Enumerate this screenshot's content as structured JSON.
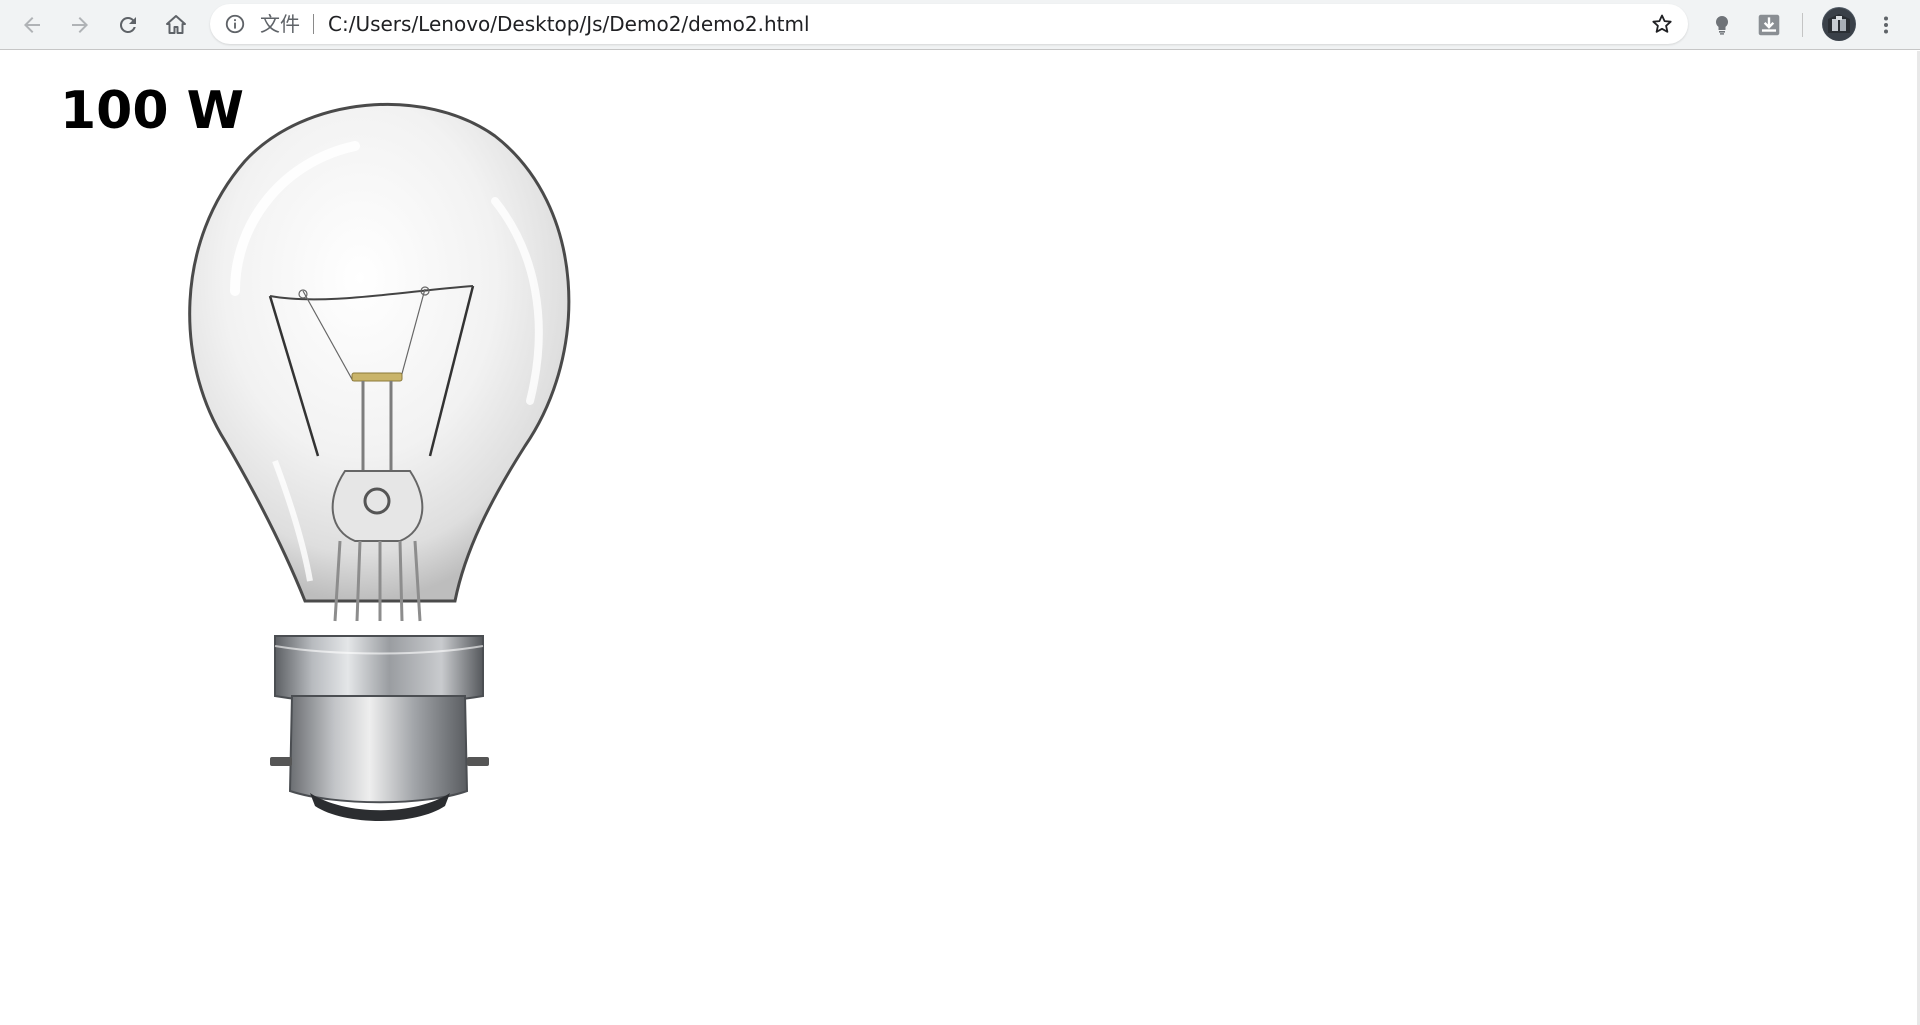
{
  "browser": {
    "back_icon": "arrow-left-icon",
    "forward_icon": "arrow-right-icon",
    "reload_icon": "reload-icon",
    "home_icon": "home-icon",
    "omnibox": {
      "info_icon": "info-icon",
      "scheme_label": "文件",
      "url": "C:/Users/Lenovo/Desktop/Js/Demo2/demo2.html",
      "star_icon": "star-outline-icon"
    },
    "extensions": [
      "lightbulb-extension-icon",
      "download-extension-icon"
    ],
    "avatar_icon": "profile-avatar",
    "menu_icon": "kebab-menu-icon",
    "colors": {
      "toolbar_bg": "#f1f3f4",
      "icon": "#5f6368",
      "icon_disabled": "#b0b3b6"
    }
  },
  "page": {
    "power_label": "100 W",
    "bulb_image": "incandescent-light-bulb-off"
  }
}
